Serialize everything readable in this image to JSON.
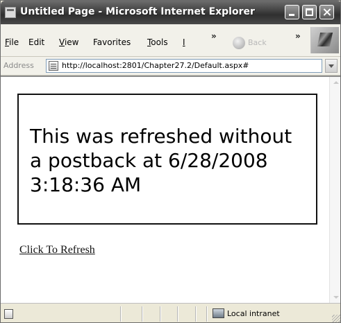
{
  "window": {
    "title": "Untitled Page - Microsoft Internet Explorer"
  },
  "menu": {
    "items": [
      {
        "access_key": "F",
        "rest": "ile"
      },
      {
        "access_key": "",
        "rest": "Edit"
      },
      {
        "access_key": "V",
        "rest": "iew"
      },
      {
        "access_key": "",
        "rest": "Favorites"
      },
      {
        "access_key": "T",
        "rest": "ools"
      },
      {
        "access_key": "I",
        "rest": ""
      }
    ],
    "overflow_glyph": "»",
    "back_label": "Back"
  },
  "address": {
    "label": "Address",
    "url": "http://localhost:2801/Chapter27.2/Default.aspx#"
  },
  "page": {
    "message": "This was refreshed without a postback at 6/28/2008 3:18:36 AM",
    "link_text": "Click To Refresh"
  },
  "status": {
    "zone": "Local intranet"
  },
  "icons": {
    "window": "ie-page-icon",
    "back": "back-arrow-icon",
    "logo": "windows-logo-icon",
    "address_page": "page-icon",
    "zone": "local-intranet-icon"
  }
}
